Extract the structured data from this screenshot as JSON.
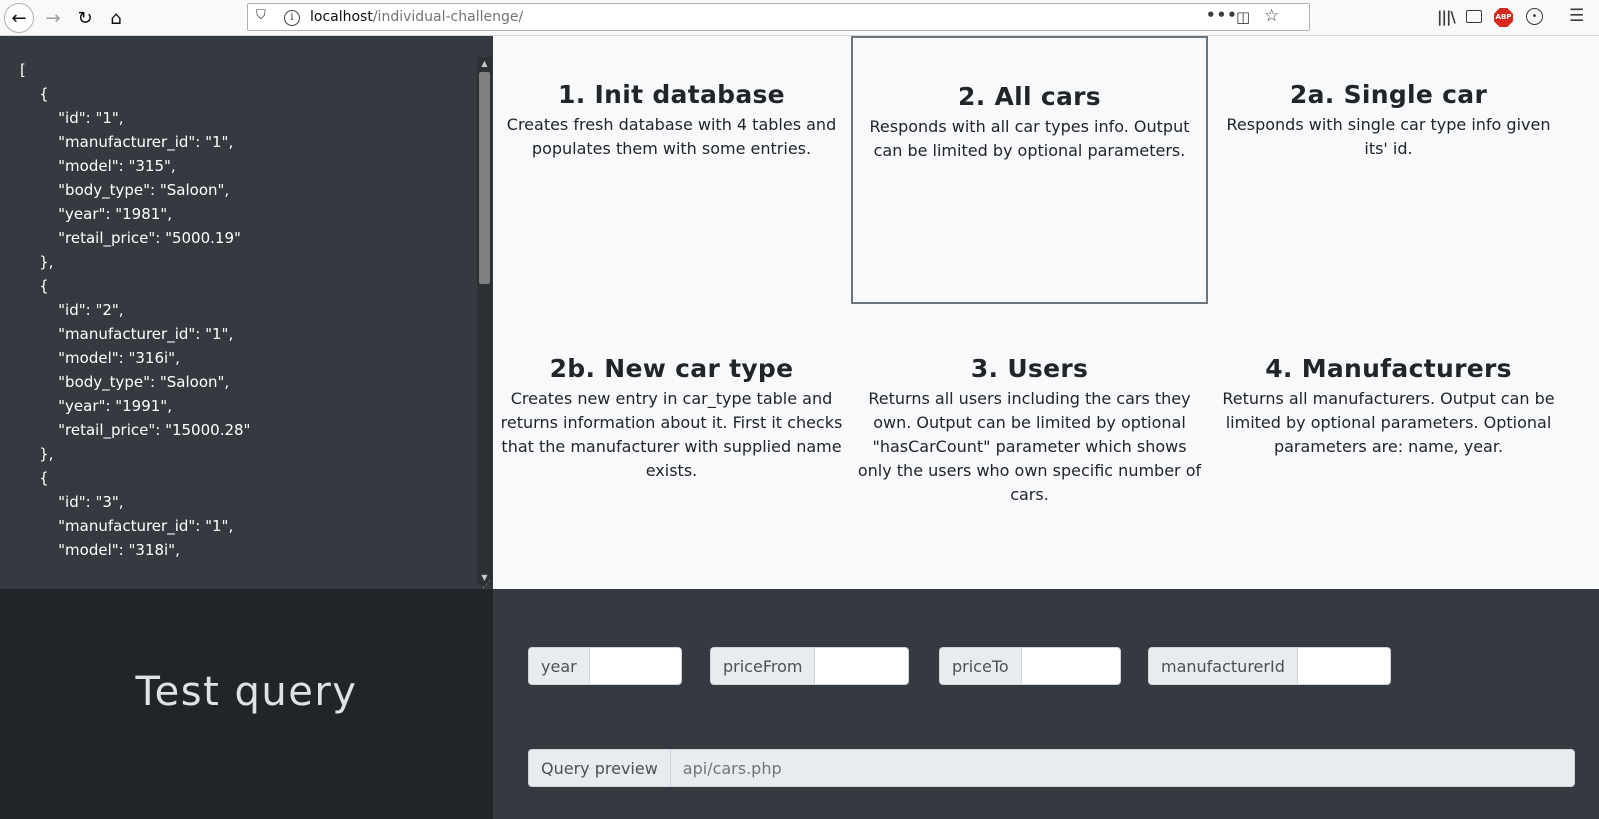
{
  "browser": {
    "url_host": "localhost",
    "url_path": "/individual-challenge/"
  },
  "json_output": "[\n    {\n        \"id\": \"1\",\n        \"manufacturer_id\": \"1\",\n        \"model\": \"315\",\n        \"body_type\": \"Saloon\",\n        \"year\": \"1981\",\n        \"retail_price\": \"5000.19\"\n    },\n    {\n        \"id\": \"2\",\n        \"manufacturer_id\": \"1\",\n        \"model\": \"316i\",\n        \"body_type\": \"Saloon\",\n        \"year\": \"1991\",\n        \"retail_price\": \"15000.28\"\n    },\n    {\n        \"id\": \"3\",\n        \"manufacturer_id\": \"1\",\n        \"model\": \"318i\",",
  "cards": [
    {
      "title": "1. Init database",
      "desc": "Creates fresh database with 4 tables and populates them with some entries."
    },
    {
      "title": "2. All cars",
      "desc": "Responds with all car types info. Output can be limited by optional parameters."
    },
    {
      "title": "2a. Single car",
      "desc": "Responds with single car type info given its' id."
    },
    {
      "title": "2b. New car type",
      "desc": "Creates new entry in car_type table and returns information about it. First it checks that the manufacturer with supplied name exists."
    },
    {
      "title": "3. Users",
      "desc": "Returns all users including the cars they own. Output can be limited by optional \"hasCarCount\" parameter which shows only the users who own specific number of cars."
    },
    {
      "title": "4. Manufacturers",
      "desc": "Returns all manufacturers. Output can be limited by optional parameters. Optional parameters are: name, year."
    }
  ],
  "test": {
    "title": "Test query",
    "params": [
      "year",
      "priceFrom",
      "priceTo",
      "manufacturerId"
    ],
    "preview_label": "Query preview",
    "preview_value": "api/cars.php"
  }
}
